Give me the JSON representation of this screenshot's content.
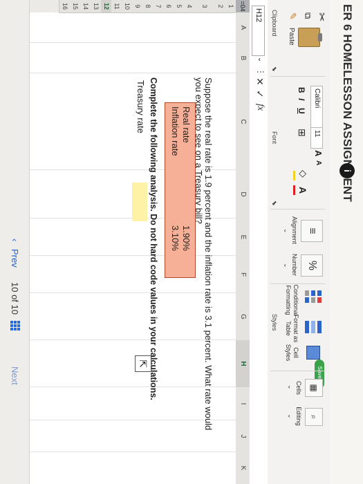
{
  "assignment": {
    "title": "ER 6 HOMELESSON ASSIGNMENT",
    "info_glyph": "i"
  },
  "ribbon": {
    "saved": "Saved",
    "paste_label": "Paste",
    "clipboard_label": "Clipboard",
    "font_name": "Calibri",
    "font_size": "11",
    "grow_font": "A",
    "shrink_font": "A",
    "font_label": "Font",
    "bold": "B",
    "italic": "I",
    "underline": "U",
    "alignment_label": "Alignment",
    "number_label": "Number",
    "percent": "%",
    "cond_format_line1": "Conditional",
    "cond_format_line2": "Formatting",
    "format_table_line1": "Format as",
    "format_table_line2": "Table",
    "cell_styles_line1": "Cell",
    "cell_styles_line2": "Styles",
    "styles_label": "Styles",
    "cells_label": "Cells",
    "editing_label": "Editing"
  },
  "formula_bar": {
    "name_box": "H12",
    "cancel": "✕",
    "enter": "✓",
    "fx": "fx"
  },
  "columns": [
    "A",
    "B",
    "C",
    "D",
    "E",
    "F",
    "G",
    "H",
    "I",
    "J",
    "K"
  ],
  "selected_column": "H",
  "rows": [
    "1",
    "2",
    "3",
    "4",
    "5",
    "6",
    "7",
    "8",
    "9",
    "10",
    "11",
    "12",
    "13",
    "14",
    "15",
    "16"
  ],
  "selected_row": "12",
  "left_tab": "=04",
  "sheet": {
    "question_line1": "Suppose the real rate is 1.9 percent and the inflation rate is 3.1 percent. What rate would",
    "question_line2": "you expect to see on a Treasury bill?",
    "real_rate_label": "Real rate",
    "real_rate_value": "1.90%",
    "inflation_rate_label": "Inflation rate",
    "inflation_rate_value": "3.10%",
    "instruction": "Complete the following analysis. Do not hard code values in your calculations.",
    "treasury_rate_label": "Treasury rate"
  },
  "pager": {
    "prev": "Prev",
    "position": "10 of 10",
    "next": "Next"
  }
}
